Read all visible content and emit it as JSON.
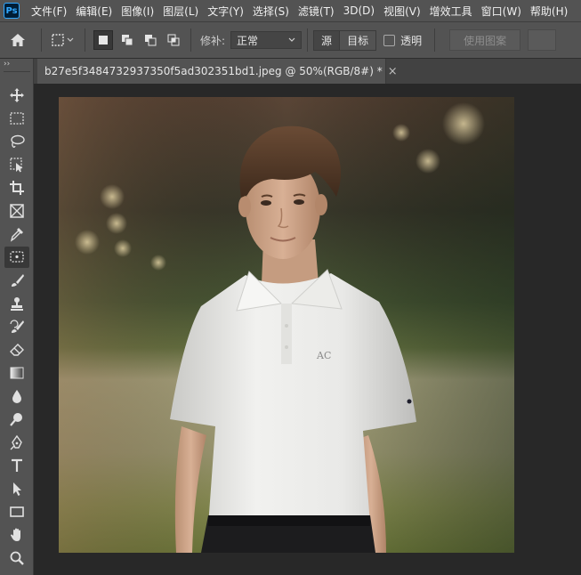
{
  "app_logo": "Ps",
  "menu": [
    "文件(F)",
    "编辑(E)",
    "图像(I)",
    "图层(L)",
    "文字(Y)",
    "选择(S)",
    "滤镜(T)",
    "3D(D)",
    "视图(V)",
    "增效工具",
    "窗口(W)",
    "帮助(H)"
  ],
  "options": {
    "patch_label": "修补:",
    "patch_mode": "正常",
    "source_label": "源",
    "target_label": "目标",
    "transparent_label": "透明",
    "use_pattern_label": "使用图案"
  },
  "document": {
    "tab_title": "b27e5f3484732937350f5ad302351bd1.jpeg @ 50%(RGB/8#) *",
    "close_glyph": "×",
    "shirt_logo": "AC"
  },
  "tools": [
    "move-icon",
    "marquee-icon",
    "lasso-icon",
    "object-select-icon",
    "crop-icon",
    "frame-icon",
    "eyedropper-icon",
    "patch-icon",
    "brush-icon",
    "stamp-icon",
    "history-brush-icon",
    "eraser-icon",
    "gradient-icon",
    "blur-icon",
    "dodge-icon",
    "pen-icon",
    "type-icon",
    "path-select-icon",
    "rectangle-icon",
    "hand-icon",
    "zoom-icon"
  ],
  "colors": {
    "accent": "#31a8ff",
    "panel": "#535353",
    "canvas_bg": "#282828"
  }
}
